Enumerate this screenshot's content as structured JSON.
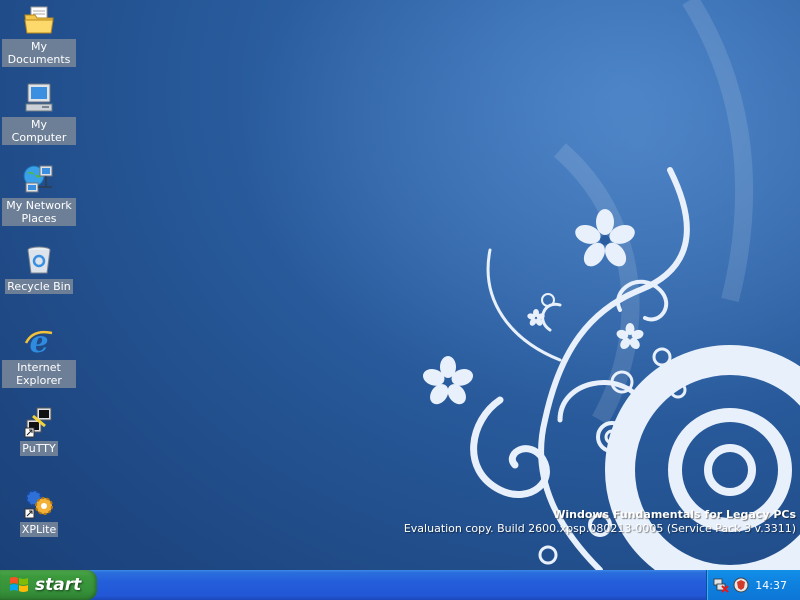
{
  "desktop": {
    "icons": [
      {
        "label": "My Documents",
        "icon": "folder-documents-icon"
      },
      {
        "label": "My Computer",
        "icon": "computer-icon"
      },
      {
        "label": "My Network Places",
        "icon": "network-places-icon"
      },
      {
        "label": "Recycle Bin",
        "icon": "recycle-bin-icon"
      },
      {
        "label": "Internet Explorer",
        "icon": "internet-explorer-icon"
      },
      {
        "label": "PuTTY",
        "icon": "putty-icon"
      },
      {
        "label": "XPLite",
        "icon": "xplite-icon"
      }
    ],
    "watermark": {
      "line1": "Windows Fundamentals for Legacy PCs",
      "line2": "Evaluation copy. Build 2600.xpsp.080213-0005 (Service Pack 3 v.3311)"
    }
  },
  "taskbar": {
    "start_label": "start",
    "tray": {
      "icons": [
        "network-disconnected-icon",
        "security-shield-icon"
      ],
      "clock": "14:37"
    }
  },
  "colors": {
    "desktop_blue": "#2a5d9f",
    "taskbar_blue": "#245edb",
    "start_green": "#3c9a3c",
    "tray_blue": "#0f82e0"
  }
}
